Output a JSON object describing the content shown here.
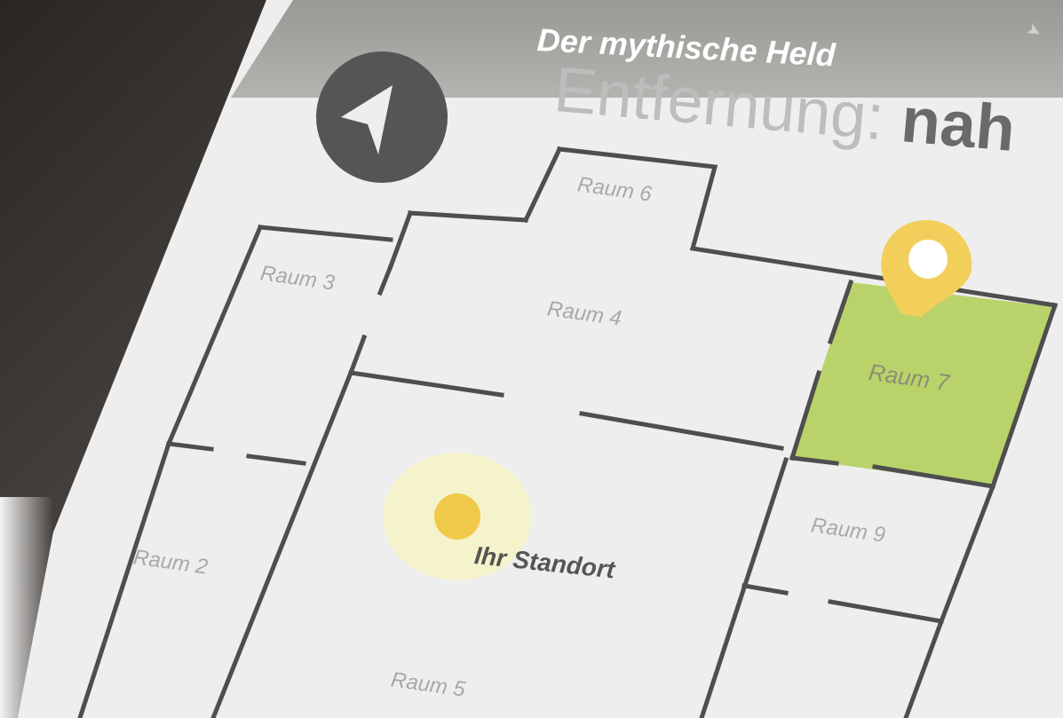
{
  "app": {
    "title": "Der mythische Held",
    "distance_label": "Entfernung: ",
    "distance_value": "nah"
  },
  "map": {
    "highlight_color": "#b9d36a",
    "marker_color": "#f2cf5a",
    "rooms": [
      {
        "id": "raum-6",
        "label": "Raum 6"
      },
      {
        "id": "raum-3",
        "label": "Raum 3"
      },
      {
        "id": "raum-4",
        "label": "Raum 4"
      },
      {
        "id": "raum-7",
        "label": "Raum 7",
        "highlighted": true
      },
      {
        "id": "raum-2",
        "label": "Raum 2"
      },
      {
        "id": "raum-9",
        "label": "Raum 9"
      },
      {
        "id": "raum-5",
        "label": "Raum 5"
      }
    ],
    "location_label": "Ihr Standort"
  },
  "icons": {
    "navigation": "navigation-arrow-icon",
    "destination": "map-pin-icon",
    "current_location": "location-dot-icon"
  }
}
